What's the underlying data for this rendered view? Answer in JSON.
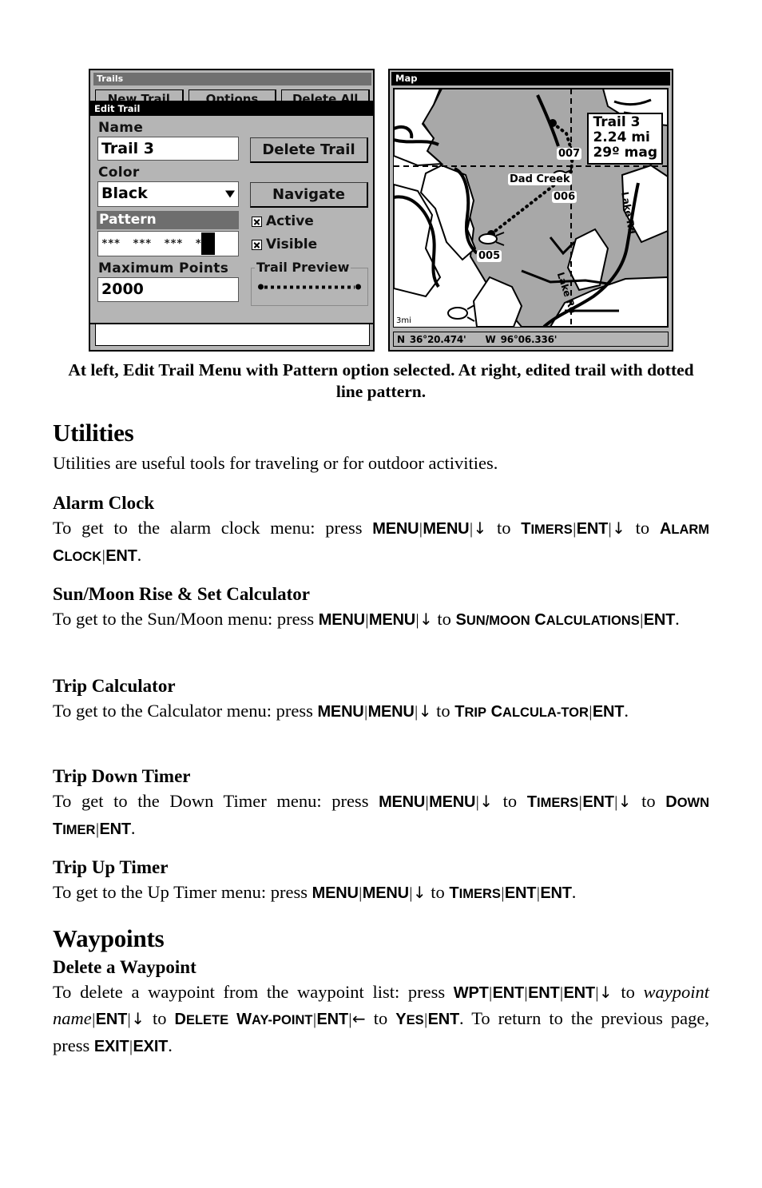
{
  "figure": {
    "left_screen": {
      "window_title": "Trails",
      "buttons_behind": [
        "New Trail",
        "Options",
        "Delete All"
      ],
      "dialog": {
        "title": "Edit Trail",
        "name_label": "Name",
        "name_value": "Trail 3",
        "color_label": "Color",
        "color_value": "Black",
        "pattern_label": "Pattern",
        "pattern_value": "***  ***  ***  ***",
        "max_points_label": "Maximum Points",
        "max_points_value": "2000",
        "delete_button": "Delete Trail",
        "navigate_button": "Navigate",
        "active_checkbox": "Active",
        "visible_checkbox": "Visible",
        "trail_preview_label": "Trail Preview"
      }
    },
    "right_screen": {
      "window_title": "Map",
      "info_box": {
        "trail_name": "Trail 3",
        "distance": "2.24 mi",
        "bearing": "29º mag"
      },
      "map_labels": [
        "Dad Creek",
        "007",
        "006",
        "005",
        "Lake Rd",
        "Lake Rd"
      ],
      "scale": "3mi",
      "status_bar": {
        "lat_hemisphere": "N",
        "latitude": "36°20.474'",
        "lon_hemisphere": "W",
        "longitude": "96°06.336'"
      }
    },
    "caption": "At left, Edit Trail Menu with Pattern option selected. At right, edited trail with dotted line pattern."
  },
  "content": {
    "utilities": {
      "heading": "Utilities",
      "intro": "Utilities are useful tools for traveling or for outdoor activities.",
      "sections": [
        {
          "heading": "Alarm Clock",
          "lead": "To get to the alarm clock menu: press ",
          "trail": "."
        },
        {
          "heading": "Sun/Moon Rise & Set Calculator",
          "lead": "To get to the Sun/Moon menu: press ",
          "trail": "."
        },
        {
          "heading": "Trip Calculator",
          "lead": "To get to the Calculator menu: press ",
          "trail": "."
        },
        {
          "heading": "Trip Down Timer",
          "lead": "To get to the Down Timer menu: press ",
          "trail": "."
        },
        {
          "heading": "Trip Up Timer",
          "lead": "To get to the Up Timer menu: press ",
          "trail": "."
        }
      ]
    },
    "waypoints": {
      "heading": "Waypoints",
      "sub_heading": "Delete a Waypoint",
      "delete_lead": "To delete a waypoint from the waypoint list: press ",
      "delete_mid": "To return to the previous page, press ",
      "period": "."
    },
    "keys": {
      "menu": "MENU",
      "ent": "ENT",
      "wpt": "WPT",
      "exit": "EXIT",
      "down_arrow": "↓",
      "left_arrow": "←",
      "to": "to",
      "pipe": "|"
    },
    "menu_items": {
      "timers": {
        "cap": "T",
        "rest": "IMERS"
      },
      "alarm_clock_1": {
        "cap": "A",
        "rest": "LARM"
      },
      "alarm_clock_2": {
        "cap": "C",
        "rest": "LOCK"
      },
      "sun_moon": {
        "cap": "S",
        "rest": "UN/M",
        "cap2": "",
        "rest2": "OON"
      },
      "calculations": {
        "cap": "C",
        "rest": "ALCULATIONS"
      },
      "trip": {
        "cap": "T",
        "rest": "RIP"
      },
      "calcula": {
        "cap": "C",
        "rest": "ALCULA-"
      },
      "tor": {
        "rest": "TOR"
      },
      "down": {
        "cap": "D",
        "rest": "OWN"
      },
      "timer": {
        "cap": "T",
        "rest": "IMER"
      },
      "delete": {
        "cap": "D",
        "rest": "ELETE"
      },
      "way": {
        "cap": "W",
        "rest": "AY-"
      },
      "point": {
        "rest": "POINT"
      },
      "yes": {
        "cap": "Y",
        "rest": "ES"
      },
      "waypoint_name": "waypoint name"
    }
  }
}
